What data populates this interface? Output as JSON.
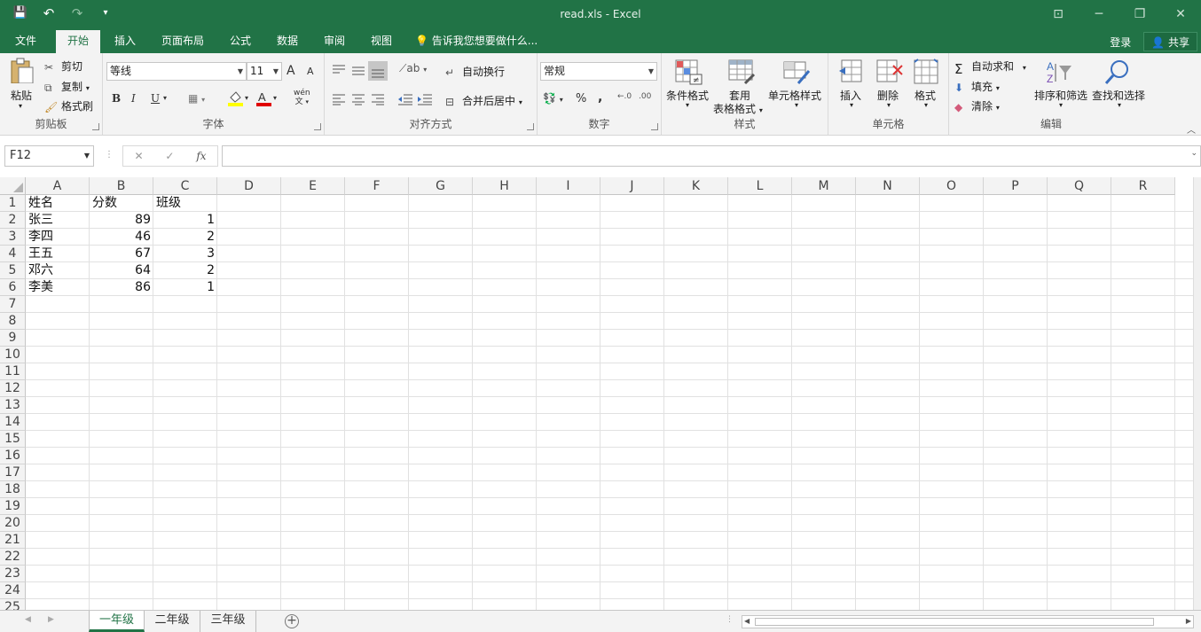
{
  "window": {
    "title": "read.xls - Excel",
    "controls": [
      "⊡",
      "─",
      "❐",
      "✕"
    ]
  },
  "qat": {
    "save": "💾",
    "undo": "↶",
    "redo": "↷",
    "customize": "▾"
  },
  "tabs": [
    {
      "label": "文件",
      "active": false
    },
    {
      "label": "开始",
      "active": true
    },
    {
      "label": "插入",
      "active": false
    },
    {
      "label": "页面布局",
      "active": false
    },
    {
      "label": "公式",
      "active": false
    },
    {
      "label": "数据",
      "active": false
    },
    {
      "label": "审阅",
      "active": false
    },
    {
      "label": "视图",
      "active": false
    }
  ],
  "tellme": "告诉我您想要做什么...",
  "account": {
    "login": "登录",
    "share": "共享"
  },
  "ribbon": {
    "clipboard": {
      "label": "剪贴板",
      "paste": "粘贴",
      "cut": "剪切",
      "copy": "复制",
      "format_painter": "格式刷"
    },
    "font": {
      "label": "字体",
      "name": "等线",
      "size": "11",
      "grow": "A",
      "shrink": "A",
      "bold": "B",
      "italic": "I",
      "underline": "U",
      "phonetic": "wén"
    },
    "alignment": {
      "label": "对齐方式",
      "wrap": "自动换行",
      "merge": "合并后居中"
    },
    "number": {
      "label": "数字",
      "format": "常规",
      "percent": "%",
      "comma": ","
    },
    "styles": {
      "label": "样式",
      "conditional": "条件格式",
      "table": "套用",
      "table2": "表格格式",
      "cell_styles": "单元格样式"
    },
    "cells": {
      "label": "单元格",
      "insert": "插入",
      "delete": "删除",
      "format": "格式"
    },
    "editing": {
      "label": "编辑",
      "autosum": "自动求和",
      "fill": "填充",
      "clear": "清除",
      "sort": "排序和筛选",
      "find": "查找和选择"
    }
  },
  "formula_bar": {
    "name_box": "F12",
    "fx": "fx",
    "cancel": "✕",
    "enter": "✓",
    "value": ""
  },
  "columns": [
    "A",
    "B",
    "C",
    "D",
    "E",
    "F",
    "G",
    "H",
    "I",
    "J",
    "K",
    "L",
    "M",
    "N",
    "O",
    "P",
    "Q",
    "R"
  ],
  "rows": [
    "1",
    "2",
    "3",
    "4",
    "5",
    "6",
    "7",
    "8",
    "9",
    "10",
    "11",
    "12",
    "13",
    "14",
    "15",
    "16",
    "17",
    "18",
    "19",
    "20",
    "21",
    "22",
    "23",
    "24",
    "25"
  ],
  "cells": {
    "headers": [
      "姓名",
      "分数",
      "班级"
    ],
    "data": [
      {
        "name": "张三",
        "score": "89",
        "class": "1"
      },
      {
        "name": "李四",
        "score": "46",
        "class": "2"
      },
      {
        "name": "王五",
        "score": "67",
        "class": "3"
      },
      {
        "name": "邓六",
        "score": "64",
        "class": "2"
      },
      {
        "name": "李美",
        "score": "86",
        "class": "1"
      }
    ]
  },
  "sheets": [
    {
      "label": "一年级",
      "active": true
    },
    {
      "label": "二年级",
      "active": false
    },
    {
      "label": "三年级",
      "active": false
    }
  ],
  "colors": {
    "accent": "#217346",
    "ribbon_bg": "#f3f3f3"
  }
}
